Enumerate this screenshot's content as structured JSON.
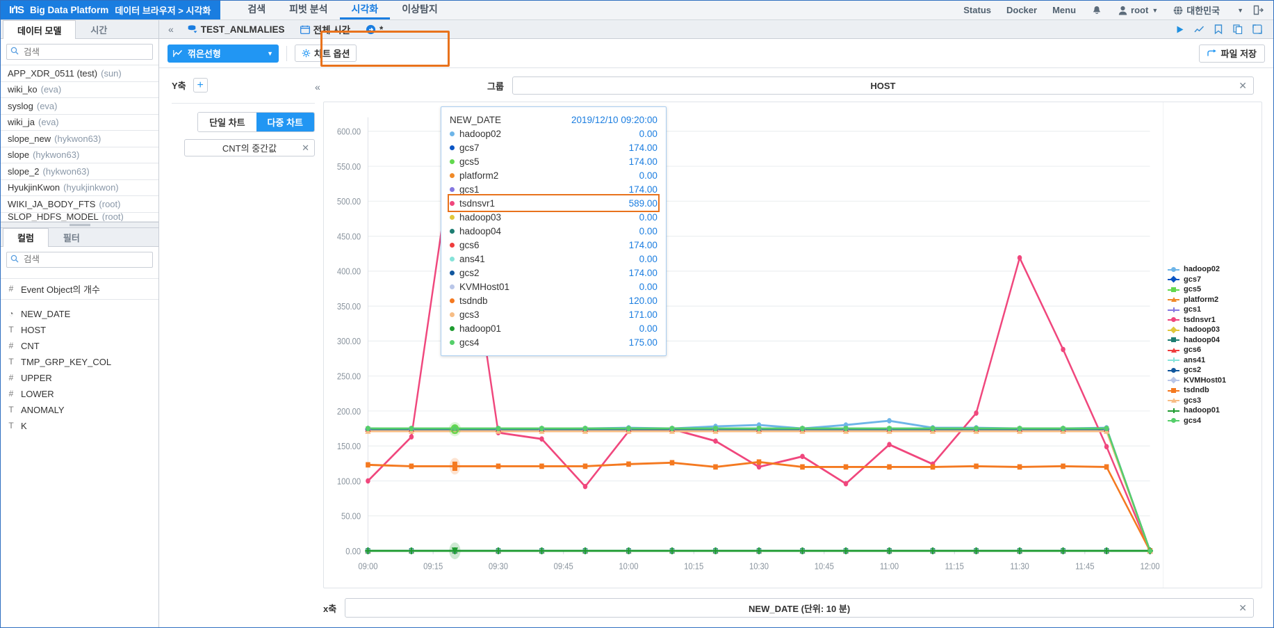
{
  "header": {
    "brand_iris": "IґIS",
    "brand_product": "Big Data Platform",
    "breadcrumb": "데이터 브라우저 > 시각화",
    "nav": [
      {
        "label": "검색",
        "active": false
      },
      {
        "label": "피벗 분석",
        "active": false
      },
      {
        "label": "시각화",
        "active": true
      },
      {
        "label": "이상탐지",
        "active": false
      }
    ],
    "right": {
      "status": "Status",
      "docker": "Docker",
      "menu": "Menu",
      "bell_icon": "bell-icon",
      "user_icon": "user-icon",
      "user": "root",
      "globe_icon": "globe-icon",
      "locale": "대한민국",
      "logout_icon": "logout-icon"
    }
  },
  "sidebar": {
    "tabs": [
      {
        "label": "데이터 모델",
        "active": true
      },
      {
        "label": "시간",
        "active": false
      }
    ],
    "search_placeholder": "검색",
    "models": [
      {
        "name": "APP_XDR_0511 (test)",
        "owner": "(sun)"
      },
      {
        "name": "wiki_ko",
        "owner": "(eva)"
      },
      {
        "name": "syslog",
        "owner": "(eva)"
      },
      {
        "name": "wiki_ja",
        "owner": "(eva)"
      },
      {
        "name": "slope_new",
        "owner": "(hykwon63)"
      },
      {
        "name": "slope",
        "owner": "(hykwon63)"
      },
      {
        "name": "slope_2",
        "owner": "(hykwon63)"
      },
      {
        "name": "HyukjinKwon",
        "owner": "(hyukjinkwon)"
      },
      {
        "name": "WIKI_JA_BODY_FTS",
        "owner": "(root)"
      },
      {
        "name": "SLOP_HDFS_MODEL",
        "owner": "(root)"
      }
    ],
    "coltabs": [
      {
        "label": "컬럼",
        "active": true
      },
      {
        "label": "필터",
        "active": false
      }
    ],
    "col_search_placeholder": "검색",
    "columns": [
      {
        "type": "#",
        "label": "Event Object의 개수",
        "first": true
      },
      {
        "type": "◔",
        "label": "NEW_DATE",
        "first": false
      },
      {
        "type": "T",
        "label": "HOST",
        "first": false
      },
      {
        "type": "#",
        "label": "CNT",
        "first": false
      },
      {
        "type": "T",
        "label": "TMP_GRP_KEY_COL",
        "first": false
      },
      {
        "type": "#",
        "label": "UPPER",
        "first": false
      },
      {
        "type": "#",
        "label": "LOWER",
        "first": false
      },
      {
        "type": "T",
        "label": "ANOMALY",
        "first": false
      },
      {
        "type": "T",
        "label": "K",
        "first": false
      }
    ]
  },
  "context": {
    "collapse_icon": "collapse-left-icon",
    "model_icon": "data-model-icon",
    "model_name": "TEST_ANLMALIES",
    "time_icon": "calendar-icon",
    "time_label": "전체 시간",
    "run_icon": "arrow-right-circle-icon",
    "asterisk": "*",
    "actions": [
      {
        "name": "run-button",
        "glyph": "▶"
      },
      {
        "name": "chart-button",
        "glyph": "📈"
      },
      {
        "name": "bookmark-button",
        "glyph": "🔖"
      },
      {
        "name": "copy-button",
        "glyph": "🗐"
      },
      {
        "name": "share-button",
        "glyph": "⇱"
      }
    ]
  },
  "toolbar": {
    "chart_type_icon": "line-chart-icon",
    "chart_type": "꺾은선형",
    "chart_options_icon": "gear-icon",
    "chart_options": "차트 옵션",
    "save_icon": "save-arrow-icon",
    "save_label": "파일 저장"
  },
  "yaxis": {
    "label": "Y축",
    "add_icon": "plus-icon",
    "single_chart": "단일 차트",
    "multi_chart": "다중 차트",
    "multi_active": true,
    "measure": "CNT의 중간값",
    "remove_icon": "close-icon",
    "collapse_icon": "collapse-left-icon"
  },
  "group": {
    "label": "그룹",
    "value": "HOST",
    "remove_icon": "close-icon"
  },
  "xaxis": {
    "label": "x축",
    "value": "NEW_DATE (단위: 10 분)",
    "remove_icon": "close-icon"
  },
  "tooltip": {
    "date_label": "NEW_DATE",
    "date_value": "2019/12/10 09:20:00",
    "highlight_series": "tsdnsvr1",
    "rows": [
      {
        "name": "hadoop02",
        "value": "0.00",
        "color": "#6eb5e8"
      },
      {
        "name": "gcs7",
        "value": "174.00",
        "color": "#0b55c4"
      },
      {
        "name": "gcs5",
        "value": "174.00",
        "color": "#62d84e"
      },
      {
        "name": "platform2",
        "value": "0.00",
        "color": "#f08a28"
      },
      {
        "name": "gcs1",
        "value": "174.00",
        "color": "#8577e0"
      },
      {
        "name": "tsdnsvr1",
        "value": "589.00",
        "color": "#f0477d"
      },
      {
        "name": "hadoop03",
        "value": "0.00",
        "color": "#e0c73a"
      },
      {
        "name": "hadoop04",
        "value": "0.00",
        "color": "#1d7d72"
      },
      {
        "name": "gcs6",
        "value": "174.00",
        "color": "#ef3d3d"
      },
      {
        "name": "ans41",
        "value": "0.00",
        "color": "#86e3d9"
      },
      {
        "name": "gcs2",
        "value": "174.00",
        "color": "#11579e"
      },
      {
        "name": "KVMHost01",
        "value": "0.00",
        "color": "#b9c6e8"
      },
      {
        "name": "tsdndb",
        "value": "120.00",
        "color": "#f47920"
      },
      {
        "name": "gcs3",
        "value": "171.00",
        "color": "#f7bd85"
      },
      {
        "name": "hadoop01",
        "value": "0.00",
        "color": "#1f9b30"
      },
      {
        "name": "gcs4",
        "value": "175.00",
        "color": "#55cf6a"
      }
    ]
  },
  "chart_data": {
    "type": "line",
    "title": "",
    "xlabel": "NEW_DATE (단위: 10 분)",
    "ylabel": "CNT의 중간값",
    "ylim": [
      0,
      620
    ],
    "yticks": [
      0,
      50,
      100,
      150,
      200,
      250,
      300,
      350,
      400,
      450,
      500,
      550,
      600
    ],
    "ytick_labels": [
      "0.00",
      "50.00",
      "100.00",
      "150.00",
      "200.00",
      "250.00",
      "300.00",
      "350.00",
      "400.00",
      "450.00",
      "500.00",
      "550.00",
      "600.00"
    ],
    "grid": true,
    "legend_position": "right",
    "x": [
      "09:00",
      "09:10",
      "09:20",
      "09:30",
      "09:40",
      "09:50",
      "10:00",
      "10:10",
      "10:20",
      "10:30",
      "10:40",
      "10:50",
      "11:00",
      "11:10",
      "11:20",
      "11:30",
      "11:40",
      "11:50",
      "12:00"
    ],
    "xtick_labels": [
      "09:00",
      "09:15",
      "09:30",
      "09:45",
      "10:00",
      "10:15",
      "10:30",
      "10:45",
      "11:00",
      "11:15",
      "11:30",
      "11:45",
      "12:00"
    ],
    "series": [
      {
        "name": "hadoop02",
        "color": "#6eb5e8",
        "symbol": "circle",
        "values": [
          175,
          174,
          174,
          174,
          174,
          175,
          176,
          175,
          178,
          180,
          175,
          180,
          186,
          176,
          176,
          175,
          175,
          176,
          0
        ]
      },
      {
        "name": "gcs7",
        "color": "#0b55c4",
        "symbol": "diamond",
        "values": [
          174,
          174,
          174,
          174,
          174,
          174,
          174,
          174,
          174,
          174,
          174,
          174,
          174,
          174,
          174,
          174,
          174,
          174,
          0
        ]
      },
      {
        "name": "gcs5",
        "color": "#62d84e",
        "symbol": "square",
        "values": [
          174,
          174,
          174,
          174,
          174,
          174,
          174,
          174,
          174,
          174,
          174,
          174,
          174,
          174,
          174,
          174,
          174,
          174,
          0
        ]
      },
      {
        "name": "platform2",
        "color": "#f08a28",
        "symbol": "triangle",
        "values": [
          0,
          0,
          0,
          0,
          0,
          0,
          0,
          0,
          0,
          0,
          0,
          0,
          0,
          0,
          0,
          0,
          0,
          0,
          0
        ]
      },
      {
        "name": "gcs1",
        "color": "#8577e0",
        "symbol": "cross",
        "values": [
          174,
          174,
          174,
          174,
          174,
          174,
          174,
          174,
          174,
          174,
          174,
          174,
          174,
          174,
          174,
          174,
          174,
          174,
          0
        ]
      },
      {
        "name": "tsdnsvr1",
        "color": "#f0477d",
        "symbol": "circle",
        "values": [
          100,
          163,
          589,
          169,
          160,
          92,
          171,
          174,
          157,
          120,
          135,
          96,
          152,
          124,
          197,
          419,
          288,
          149,
          0
        ]
      },
      {
        "name": "hadoop03",
        "color": "#e0c73a",
        "symbol": "diamond",
        "values": [
          0,
          0,
          0,
          0,
          0,
          0,
          0,
          0,
          0,
          0,
          0,
          0,
          0,
          0,
          0,
          0,
          0,
          0,
          0
        ]
      },
      {
        "name": "hadoop04",
        "color": "#1d7d72",
        "symbol": "square",
        "values": [
          0,
          0,
          0,
          0,
          0,
          0,
          0,
          0,
          0,
          0,
          0,
          0,
          0,
          0,
          0,
          0,
          0,
          0,
          0
        ]
      },
      {
        "name": "gcs6",
        "color": "#ef3d3d",
        "symbol": "triangle",
        "values": [
          174,
          174,
          174,
          174,
          174,
          174,
          174,
          174,
          174,
          174,
          174,
          174,
          174,
          174,
          174,
          174,
          174,
          174,
          0
        ]
      },
      {
        "name": "ans41",
        "color": "#86e3d9",
        "symbol": "cross",
        "values": [
          0,
          0,
          0,
          0,
          0,
          0,
          0,
          0,
          0,
          0,
          0,
          0,
          0,
          0,
          0,
          0,
          0,
          0,
          0
        ]
      },
      {
        "name": "gcs2",
        "color": "#11579e",
        "symbol": "circle",
        "values": [
          174,
          174,
          174,
          174,
          174,
          174,
          174,
          174,
          174,
          174,
          174,
          174,
          174,
          174,
          174,
          174,
          174,
          174,
          0
        ]
      },
      {
        "name": "KVMHost01",
        "color": "#b9c6e8",
        "symbol": "diamond",
        "values": [
          0,
          0,
          0,
          0,
          0,
          0,
          0,
          0,
          0,
          0,
          0,
          0,
          0,
          0,
          0,
          0,
          0,
          0,
          0
        ]
      },
      {
        "name": "tsdndb",
        "color": "#f47920",
        "symbol": "square",
        "values": [
          123,
          121,
          121,
          121,
          121,
          121,
          124,
          126,
          120,
          127,
          120,
          120,
          120,
          120,
          121,
          120,
          121,
          120,
          0
        ]
      },
      {
        "name": "gcs3",
        "color": "#f7bd85",
        "symbol": "triangle",
        "values": [
          171,
          171,
          171,
          171,
          171,
          171,
          171,
          171,
          171,
          171,
          171,
          171,
          171,
          171,
          171,
          171,
          171,
          171,
          0
        ]
      },
      {
        "name": "hadoop01",
        "color": "#1f9b30",
        "symbol": "cross",
        "values": [
          0,
          0,
          0,
          0,
          0,
          0,
          0,
          0,
          0,
          0,
          0,
          0,
          0,
          0,
          0,
          0,
          0,
          0,
          0
        ]
      },
      {
        "name": "gcs4",
        "color": "#55cf6a",
        "symbol": "circle",
        "values": [
          175,
          175,
          175,
          175,
          175,
          175,
          175,
          175,
          175,
          175,
          175,
          175,
          175,
          175,
          175,
          175,
          175,
          175,
          0
        ]
      }
    ],
    "hover_point": {
      "series": "tsdnsvr1",
      "x": "09:20",
      "y": 589
    }
  }
}
